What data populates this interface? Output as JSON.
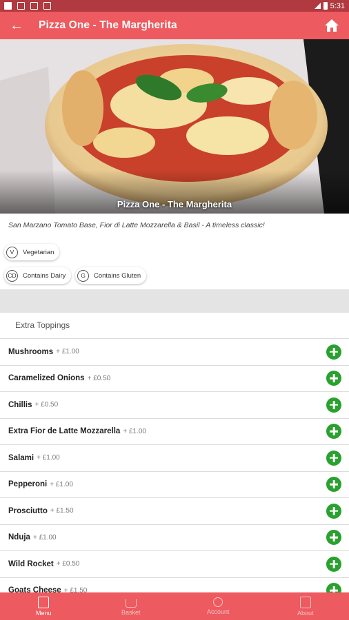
{
  "status_bar": {
    "time": "5:31"
  },
  "app_bar": {
    "title": "Pizza One - The Margherita"
  },
  "hero": {
    "caption": "Pizza One - The Margherita"
  },
  "description": "San Marzano Tomato Base, Fior di Latte Mozzarella & Basil - A timeless classic!",
  "dietary": [
    {
      "badge": "V",
      "label": "Vegetarian"
    },
    {
      "badge": "CD",
      "label": "Contains Dairy"
    },
    {
      "badge": "G",
      "label": "Contains Gluten"
    }
  ],
  "section_title": "Extra Toppings",
  "toppings": [
    {
      "name": "Mushrooms",
      "price": "+ £1.00"
    },
    {
      "name": "Caramelized Onions",
      "price": "+ £0.50"
    },
    {
      "name": "Chillis",
      "price": "+ £0.50"
    },
    {
      "name": "Extra Fior de Latte Mozzarella",
      "price": "+ £1.00"
    },
    {
      "name": "Salami",
      "price": "+ £1.00"
    },
    {
      "name": "Pepperoni",
      "price": "+ £1.00"
    },
    {
      "name": "Prosciutto",
      "price": "+ £1.50"
    },
    {
      "name": "Nduja",
      "price": "+ £1.00"
    },
    {
      "name": "Wild Rocket",
      "price": "+ £0.50"
    },
    {
      "name": "Goats Cheese",
      "price": "+ £1.50"
    }
  ],
  "bottom_nav": [
    {
      "label": "Menu",
      "icon": "menu-icon",
      "active": true
    },
    {
      "label": "Basket",
      "icon": "basket-icon",
      "active": false
    },
    {
      "label": "Account",
      "icon": "account-icon",
      "active": false
    },
    {
      "label": "About",
      "icon": "info-icon",
      "active": false
    }
  ],
  "colors": {
    "primary": "#ed5a5f",
    "status_bar": "#b03a3f",
    "add_button": "#2aa12f"
  }
}
